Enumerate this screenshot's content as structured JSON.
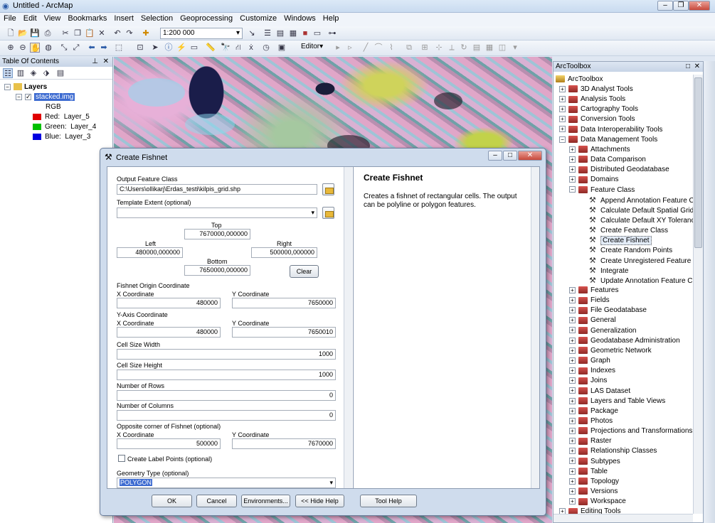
{
  "window": {
    "title": "Untitled - ArcMap"
  },
  "menu": [
    "File",
    "Edit",
    "View",
    "Bookmarks",
    "Insert",
    "Selection",
    "Geoprocessing",
    "Customize",
    "Windows",
    "Help"
  ],
  "toolbar": {
    "scale": "1:200 000",
    "editor": "Editor▾"
  },
  "toc": {
    "title": "Table Of Contents",
    "layers_label": "Layers",
    "layer_name": "stacked.img",
    "rgb": "RGB",
    "bands": [
      {
        "label": "Red:",
        "band": "Layer_5",
        "color": "#e00000"
      },
      {
        "label": "Green:",
        "band": "Layer_4",
        "color": "#00c000"
      },
      {
        "label": "Blue:",
        "band": "Layer_3",
        "color": "#0000e0"
      }
    ]
  },
  "arctoolbox": {
    "title": "ArcToolbox",
    "root": "ArcToolbox",
    "items": [
      {
        "label": "3D Analyst Tools",
        "level": 0,
        "kind": "toolbox",
        "exp": "+"
      },
      {
        "label": "Analysis Tools",
        "level": 0,
        "kind": "toolbox",
        "exp": "+"
      },
      {
        "label": "Cartography Tools",
        "level": 0,
        "kind": "toolbox",
        "exp": "+"
      },
      {
        "label": "Conversion Tools",
        "level": 0,
        "kind": "toolbox",
        "exp": "+"
      },
      {
        "label": "Data Interoperability Tools",
        "level": 0,
        "kind": "toolbox",
        "exp": "+"
      },
      {
        "label": "Data Management Tools",
        "level": 0,
        "kind": "toolbox",
        "exp": "-"
      },
      {
        "label": "Attachments",
        "level": 1,
        "kind": "toolset",
        "exp": "+"
      },
      {
        "label": "Data Comparison",
        "level": 1,
        "kind": "toolset",
        "exp": "+"
      },
      {
        "label": "Distributed Geodatabase",
        "level": 1,
        "kind": "toolset",
        "exp": "+"
      },
      {
        "label": "Domains",
        "level": 1,
        "kind": "toolset",
        "exp": "+"
      },
      {
        "label": "Feature Class",
        "level": 1,
        "kind": "toolset",
        "exp": "-"
      },
      {
        "label": "Append Annotation Feature Cl",
        "level": 2,
        "kind": "tool"
      },
      {
        "label": "Calculate Default Spatial Grid I",
        "level": 2,
        "kind": "tool"
      },
      {
        "label": "Calculate Default XY Tolerance",
        "level": 2,
        "kind": "tool"
      },
      {
        "label": "Create Feature Class",
        "level": 2,
        "kind": "tool"
      },
      {
        "label": "Create Fishnet",
        "level": 2,
        "kind": "tool",
        "selected": true
      },
      {
        "label": "Create Random Points",
        "level": 2,
        "kind": "tool"
      },
      {
        "label": "Create Unregistered Feature Cl",
        "level": 2,
        "kind": "tool"
      },
      {
        "label": "Integrate",
        "level": 2,
        "kind": "tool"
      },
      {
        "label": "Update Annotation Feature Cla",
        "level": 2,
        "kind": "tool"
      },
      {
        "label": "Features",
        "level": 1,
        "kind": "toolset",
        "exp": "+"
      },
      {
        "label": "Fields",
        "level": 1,
        "kind": "toolset",
        "exp": "+"
      },
      {
        "label": "File Geodatabase",
        "level": 1,
        "kind": "toolset",
        "exp": "+"
      },
      {
        "label": "General",
        "level": 1,
        "kind": "toolset",
        "exp": "+"
      },
      {
        "label": "Generalization",
        "level": 1,
        "kind": "toolset",
        "exp": "+"
      },
      {
        "label": "Geodatabase Administration",
        "level": 1,
        "kind": "toolset",
        "exp": "+"
      },
      {
        "label": "Geometric Network",
        "level": 1,
        "kind": "toolset",
        "exp": "+"
      },
      {
        "label": "Graph",
        "level": 1,
        "kind": "toolset",
        "exp": "+"
      },
      {
        "label": "Indexes",
        "level": 1,
        "kind": "toolset",
        "exp": "+"
      },
      {
        "label": "Joins",
        "level": 1,
        "kind": "toolset",
        "exp": "+"
      },
      {
        "label": "LAS Dataset",
        "level": 1,
        "kind": "toolset",
        "exp": "+"
      },
      {
        "label": "Layers and Table Views",
        "level": 1,
        "kind": "toolset",
        "exp": "+"
      },
      {
        "label": "Package",
        "level": 1,
        "kind": "toolset",
        "exp": "+"
      },
      {
        "label": "Photos",
        "level": 1,
        "kind": "toolset",
        "exp": "+"
      },
      {
        "label": "Projections and Transformations",
        "level": 1,
        "kind": "toolset",
        "exp": "+"
      },
      {
        "label": "Raster",
        "level": 1,
        "kind": "toolset",
        "exp": "+"
      },
      {
        "label": "Relationship Classes",
        "level": 1,
        "kind": "toolset",
        "exp": "+"
      },
      {
        "label": "Subtypes",
        "level": 1,
        "kind": "toolset",
        "exp": "+"
      },
      {
        "label": "Table",
        "level": 1,
        "kind": "toolset",
        "exp": "+"
      },
      {
        "label": "Topology",
        "level": 1,
        "kind": "toolset",
        "exp": "+"
      },
      {
        "label": "Versions",
        "level": 1,
        "kind": "toolset",
        "exp": "+"
      },
      {
        "label": "Workspace",
        "level": 1,
        "kind": "toolset",
        "exp": "+"
      },
      {
        "label": "Editing Tools",
        "level": 0,
        "kind": "toolbox",
        "exp": "+"
      }
    ]
  },
  "dialog": {
    "title": "Create Fishnet",
    "output_label": "Output Feature Class",
    "output_value": "C:\\Users\\ollikarj\\Erdas_testi\\kilpis_grid.shp",
    "template_label": "Template Extent (optional)",
    "top_label": "Top",
    "top_value": "7670000,000000",
    "left_label": "Left",
    "left_value": "480000,000000",
    "right_label": "Right",
    "right_value": "500000,000000",
    "bottom_label": "Bottom",
    "bottom_value": "7650000,000000",
    "clear": "Clear",
    "origin_label": "Fishnet Origin Coordinate",
    "x_label": "X Coordinate",
    "y_label": "Y Coordinate",
    "origin_x": "480000",
    "origin_y": "7650000",
    "yaxis_label": "Y-Axis Coordinate",
    "yaxis_x": "480000",
    "yaxis_y": "7650010",
    "cw_label": "Cell Size Width",
    "cw_value": "1000",
    "ch_label": "Cell Size Height",
    "ch_value": "1000",
    "rows_label": "Number of Rows",
    "rows_value": "0",
    "cols_label": "Number of Columns",
    "cols_value": "0",
    "opp_label": "Opposite corner of Fishnet (optional)",
    "opp_x": "500000",
    "opp_y": "7670000",
    "labelpts": "Create Label Points (optional)",
    "geom_label": "Geometry Type (optional)",
    "geom_value": "POLYGON",
    "help_title": "Create Fishnet",
    "help_text": "Creates a fishnet of rectangular cells. The output can be polyline or polygon features.",
    "buttons": {
      "ok": "OK",
      "cancel": "Cancel",
      "env": "Environments...",
      "hidehelp": "<< Hide Help",
      "toolhelp": "Tool Help"
    }
  }
}
